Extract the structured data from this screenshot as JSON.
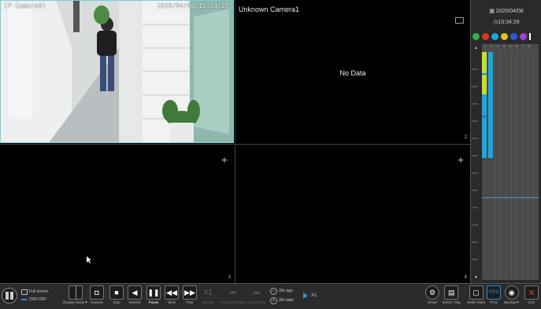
{
  "colors": {
    "accent": "#6fd3d6",
    "timeline_green": "#c2e02d",
    "timeline_blue": "#1aa6df",
    "bar_bg": "#2b2b2b",
    "play_blue": "#2e8fd6",
    "exit_red": "#e03a3a"
  },
  "cameras": [
    {
      "name": "IP Camera01",
      "osd_time": "2020/04/08 15:34:28",
      "channel": "1"
    },
    {
      "name": "Unknown Camera1",
      "status": "No Data",
      "channel": "2"
    },
    {
      "name": "",
      "channel": "3"
    },
    {
      "name": "",
      "channel": "4"
    }
  ],
  "sidebar": {
    "date": "2020/04/08",
    "time": "15:34:28",
    "channels": [
      "1",
      "2",
      "3",
      "4",
      "5",
      "6",
      "7",
      "8"
    ],
    "hours": [
      "13:00",
      "13:30",
      "14:00",
      "14:30",
      "15:00",
      "15:30",
      "16:00",
      "16:30",
      "17:00",
      "17:30",
      "18:00",
      "18:30",
      "19:00",
      "19:30"
    ]
  },
  "toolbar": {
    "full_screen": "Full screen",
    "osd_off": "OSD OFF",
    "display_mode": "Display Mode▼",
    "camera": "Camera",
    "stop": "Stop",
    "rewind": "Rewind",
    "pause": "Pause",
    "slow": "Slow",
    "fast": "Fast",
    "normal": "Normal",
    "normal_icon": "X1",
    "prev_frame": "Previous Frame",
    "next_frame": "Next Frame",
    "ago": "30s ago",
    "later": "30s later",
    "speed": "X1",
    "smart": "Smart",
    "event_tag": "Event / Tag",
    "water_mark": "Water Mark",
    "pos": "POS",
    "pos_icon": "POS",
    "backup": "Backup▼",
    "exit": "Exit"
  }
}
